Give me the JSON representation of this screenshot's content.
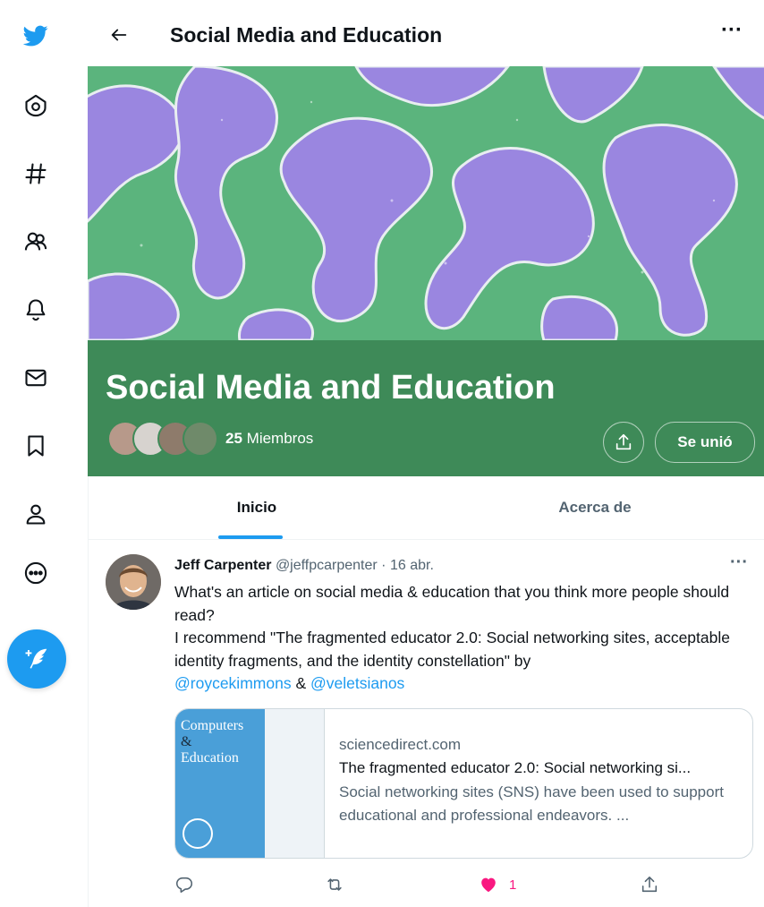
{
  "sidebar": {
    "items": [
      {
        "icon": "twitter-bird-icon"
      },
      {
        "icon": "home-icon"
      },
      {
        "icon": "explore-hashtag-icon"
      },
      {
        "icon": "communities-icon"
      },
      {
        "icon": "notifications-bell-icon"
      },
      {
        "icon": "messages-envelope-icon"
      },
      {
        "icon": "bookmarks-icon"
      },
      {
        "icon": "profile-icon"
      },
      {
        "icon": "more-circle-icon"
      }
    ],
    "compose_icon": "compose-tweet-icon",
    "accent_color": "#1d9bf0"
  },
  "header": {
    "title": "Social Media and Education",
    "more_label": "···"
  },
  "community": {
    "name": "Social Media and Education",
    "member_count": "25",
    "members_label": "Miembros",
    "joined_label": "Se unió",
    "banner_color": "#56b07a",
    "band_color": "#3e8a58"
  },
  "tabs": [
    {
      "label": "Inicio",
      "active": true
    },
    {
      "label": "Acerca de",
      "active": false
    }
  ],
  "tweet": {
    "author": "Jeff Carpenter",
    "handle": "@jeffpcarpenter",
    "separator": " · ",
    "date": "16 abr.",
    "more_label": "···",
    "line1": "What's an article on social media & education that you think more people should read?",
    "line2": "I recommend \"The fragmented educator 2.0: Social networking sites, acceptable identity fragments, and the identity constellation\" by",
    "mention1": "@roycekimmons",
    "amp": " & ",
    "mention2": "@veletsianos",
    "card": {
      "thumb_title1": "Computers",
      "thumb_amp": "&",
      "thumb_title2": "Education",
      "domain": "sciencedirect.com",
      "title": "The fragmented educator 2.0: Social networking si...",
      "description": "Social networking sites (SNS) have been used to support educational and professional endeavors. ..."
    },
    "actions": {
      "reply_icon": "reply-icon",
      "retweet_icon": "retweet-icon",
      "like_icon": "heart-icon",
      "like_count": "1",
      "share_icon": "share-icon",
      "like_color": "#f91880"
    }
  }
}
